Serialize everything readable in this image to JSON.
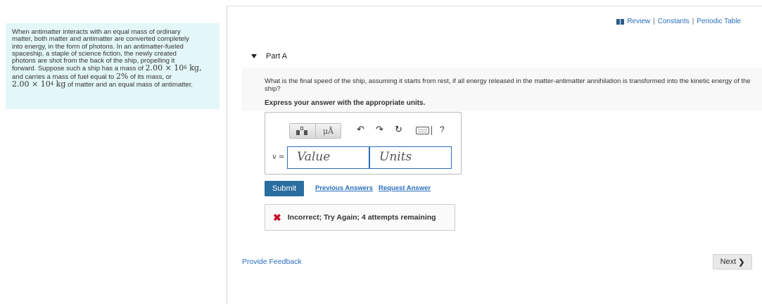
{
  "problem": {
    "line1": "When antimatter interacts with an equal mass of ordinary",
    "line2": "matter, both matter and antimatter are converted completely",
    "line3": "into energy, in the form of photons. In an antimatter-fueled",
    "line4": "spaceship, a staple of science fiction, the newly created",
    "line5": "photons are shot from the back of the ship, propelling it",
    "line6_a": "forward. Suppose such a ship has a mass of",
    "line6_mass": "2.00 × 10",
    "line6_exp": "6",
    "line6_unit": " kg,",
    "line7_a": "and carries a mass of fuel equal to",
    "line7_pct": "2%",
    "line7_b": " of its mass, or",
    "line8_m": "2.00 × 10",
    "line8_exp": "4",
    "line8_unit": " kg",
    "line8_b": " of matter and an equal mass of antimatter."
  },
  "header_links": {
    "review": "Review",
    "constants": "Constants",
    "periodic": "Periodic Table",
    "sep": "|"
  },
  "part": {
    "title": "Part A"
  },
  "question": {
    "text": "What is the final speed of the ship, assuming it starts from rest, if all energy released in the matter-antimatter annihilation is transformed into the kinetic energy of the ship?",
    "express": "Express your answer with the appropriate units."
  },
  "toolbar": {
    "units_btn": "μÅ",
    "undo": "↶",
    "redo": "↷",
    "reset": "↻",
    "help": "?"
  },
  "answer": {
    "var_label": "v =",
    "value_placeholder": "Value",
    "units_placeholder": "Units"
  },
  "actions": {
    "submit": "Submit",
    "previous": "Previous Answers",
    "request": "Request Answer"
  },
  "feedback": {
    "icon": "✖",
    "text": "Incorrect; Try Again; 4 attempts remaining"
  },
  "footer": {
    "provide": "Provide Feedback",
    "next": "Next",
    "next_chev": "❯"
  },
  "colors": {
    "accent": "#2a6ebb",
    "submit_bg": "#2a6ea0",
    "problem_bg": "#e3f6f8",
    "error": "#c8102e"
  }
}
